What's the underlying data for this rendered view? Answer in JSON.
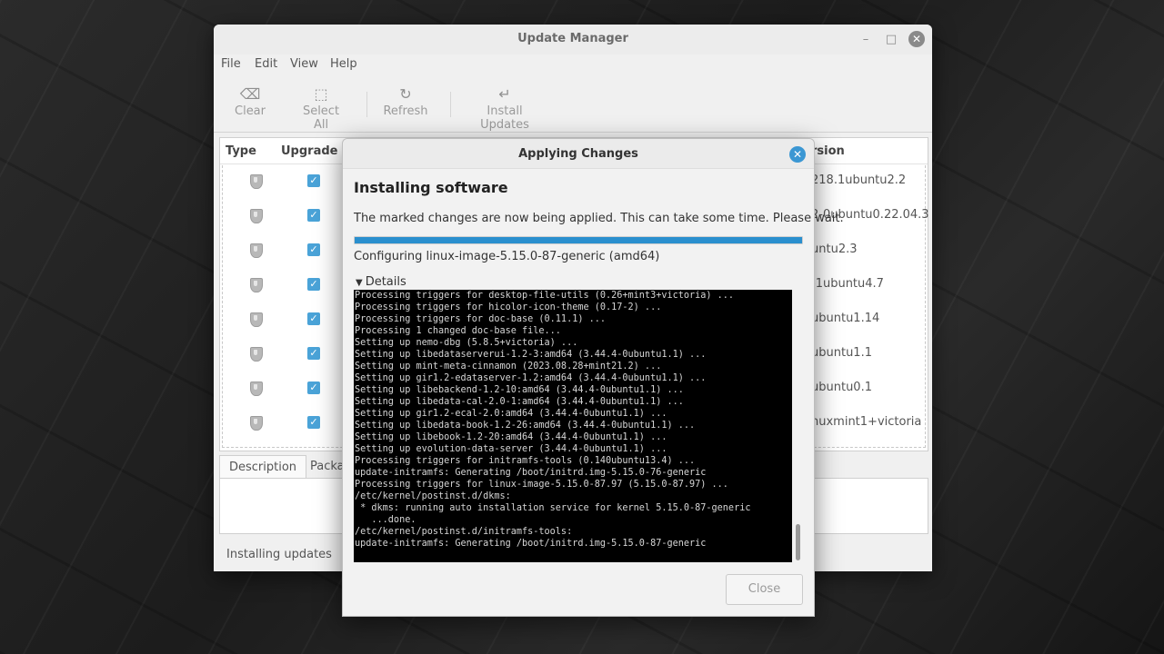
{
  "update_manager": {
    "title": "Update Manager",
    "window_controls": {
      "minimize": "–",
      "maximize": "□",
      "close": "✕"
    },
    "menu": [
      "File",
      "Edit",
      "View",
      "Help"
    ],
    "toolbar": [
      {
        "label": "Clear",
        "icon": "clear-icon",
        "glyph": "⌫"
      },
      {
        "label": "Select All",
        "icon": "select-all-icon",
        "glyph": "⬚"
      },
      {
        "label": "Refresh",
        "icon": "refresh-icon",
        "glyph": "↻"
      },
      {
        "label": "Install Updates",
        "icon": "install-icon",
        "glyph": "↵"
      }
    ],
    "columns": {
      "type": "Type",
      "upgrade": "Upgrade",
      "version": "rsion"
    },
    "rows": [
      {
        "version": "218.1ubuntu2.2",
        "checked": true
      },
      {
        "version": "2-0ubuntu0.22.04.3",
        "checked": true
      },
      {
        "version": "untu2.3",
        "checked": true
      },
      {
        "version": "-1ubuntu4.7",
        "checked": true
      },
      {
        "version": "ubuntu1.14",
        "checked": true
      },
      {
        "version": "ubuntu1.1",
        "checked": true
      },
      {
        "version": "ubuntu0.1",
        "checked": true
      },
      {
        "version": "nuxmint1+victoria",
        "checked": true
      }
    ],
    "tabs": [
      "Description",
      "Packa"
    ],
    "status": "Installing updates"
  },
  "dialog": {
    "title": "Applying Changes",
    "heading": "Installing software",
    "message": "The marked changes are now being applied. This can take some time. Please wait.",
    "progress": 1.0,
    "progress_color": "#2a8fce",
    "status": "Configuring linux-image-5.15.0-87-generic (amd64)",
    "details_label": "Details",
    "terminal_lines": [
      "Processing triggers for desktop-file-utils (0.26+mint3+victoria) ...",
      "Processing triggers for hicolor-icon-theme (0.17-2) ...",
      "Processing triggers for doc-base (0.11.1) ...",
      "Processing 1 changed doc-base file...",
      "Setting up nemo-dbg (5.8.5+victoria) ...",
      "Setting up libedataserverui-1.2-3:amd64 (3.44.4-0ubuntu1.1) ...",
      "Setting up mint-meta-cinnamon (2023.08.28+mint21.2) ...",
      "Setting up gir1.2-edataserver-1.2:amd64 (3.44.4-0ubuntu1.1) ...",
      "Setting up libebackend-1.2-10:amd64 (3.44.4-0ubuntu1.1) ...",
      "Setting up libedata-cal-2.0-1:amd64 (3.44.4-0ubuntu1.1) ...",
      "Setting up gir1.2-ecal-2.0:amd64 (3.44.4-0ubuntu1.1) ...",
      "Setting up libedata-book-1.2-26:amd64 (3.44.4-0ubuntu1.1) ...",
      "Setting up libebook-1.2-20:amd64 (3.44.4-0ubuntu1.1) ...",
      "Setting up evolution-data-server (3.44.4-0ubuntu1.1) ...",
      "Processing triggers for initramfs-tools (0.140ubuntu13.4) ...",
      "update-initramfs: Generating /boot/initrd.img-5.15.0-76-generic",
      "Processing triggers for linux-image-5.15.0-87.97 (5.15.0-87.97) ...",
      "/etc/kernel/postinst.d/dkms:",
      " * dkms: running auto installation service for kernel 5.15.0-87-generic",
      "   ...done.",
      "/etc/kernel/postinst.d/initramfs-tools:",
      "update-initramfs: Generating /boot/initrd.img-5.15.0-87-generic"
    ],
    "close_label": "Close"
  }
}
